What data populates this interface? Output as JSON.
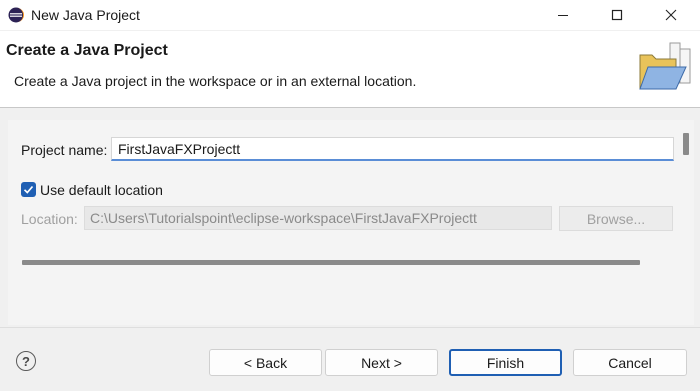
{
  "window": {
    "title": "New Java Project",
    "controls": {
      "minimize": "minimize-icon",
      "maximize": "maximize-icon",
      "close": "close-icon"
    }
  },
  "header": {
    "title": "Create a Java Project",
    "description": "Create a Java project in the workspace or in an external location.",
    "banner_icon": "new-java-project-folder-icon"
  },
  "form": {
    "project_name_label": "Project name:",
    "project_name_value": "FirstJavaFXProjectt",
    "use_default_location_label": "Use default location",
    "use_default_location_checked": true,
    "location_label": "Location:",
    "location_value": "C:\\Users\\Tutorialspoint\\eclipse-workspace\\FirstJavaFXProjectt",
    "browse_label": "Browse..."
  },
  "footer": {
    "help_icon": "help-icon",
    "help_glyph": "?",
    "back_label": "< Back",
    "next_label": "Next >",
    "finish_label": "Finish",
    "cancel_label": "Cancel"
  },
  "colors": {
    "accent": "#1f5fb3",
    "header_bg": "#ffffff",
    "body_bg": "#f0f0f0"
  }
}
